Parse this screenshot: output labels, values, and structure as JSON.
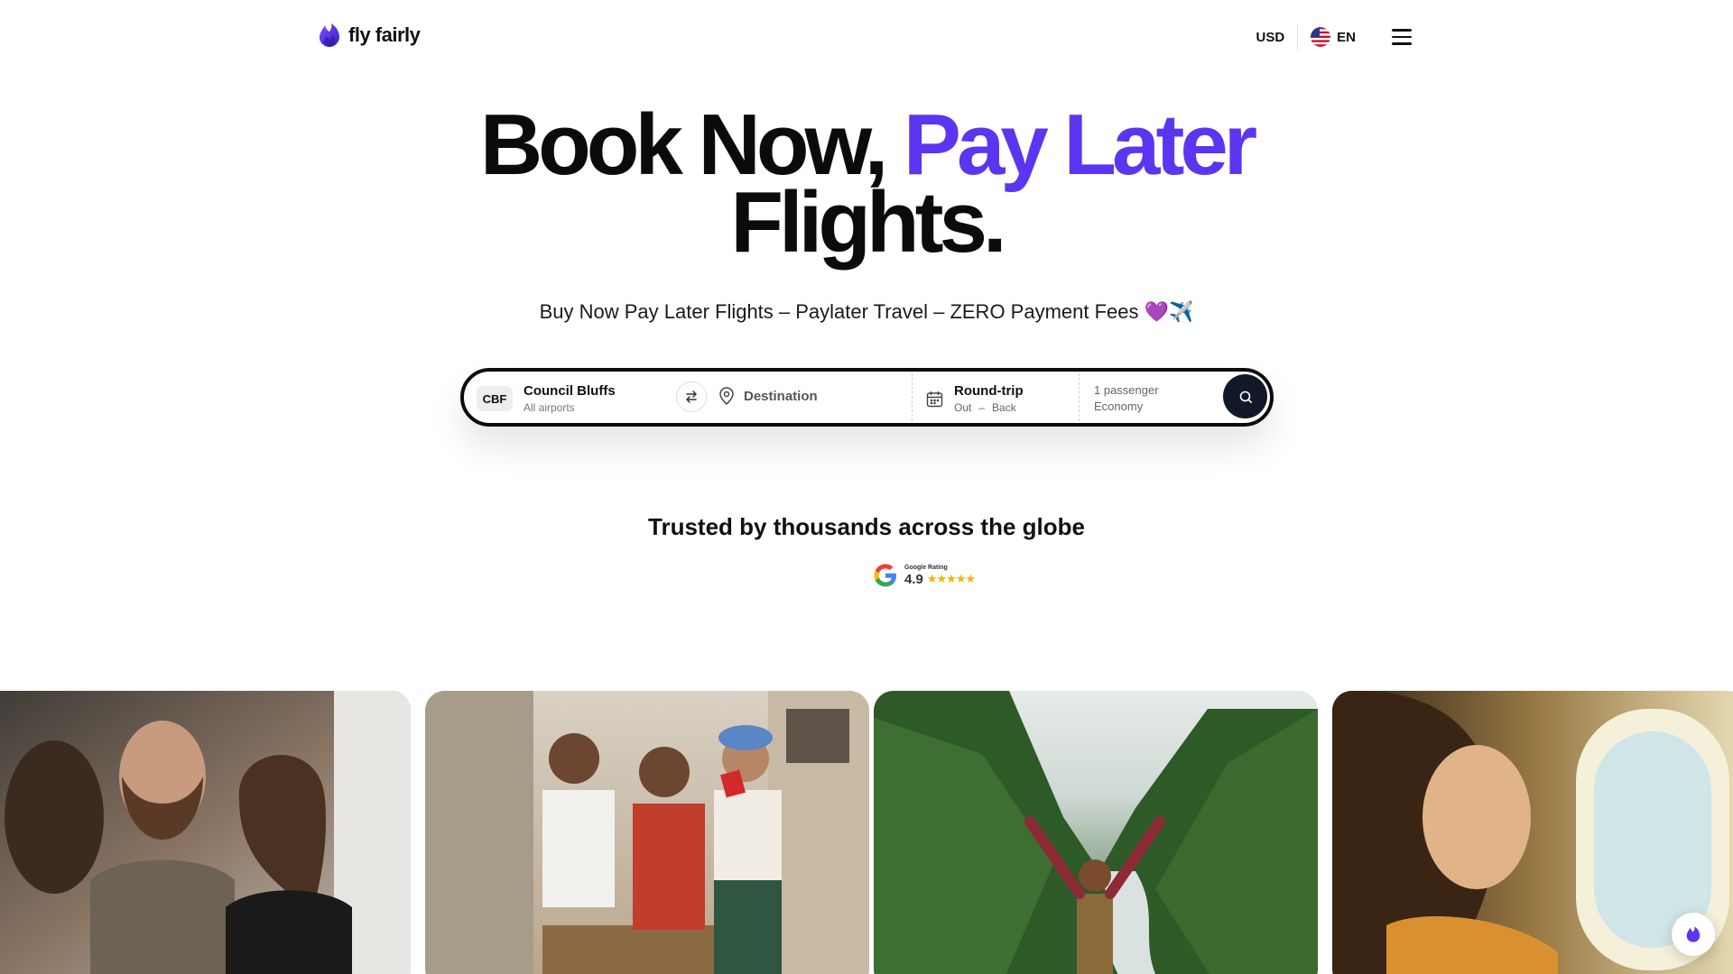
{
  "header": {
    "brand": "fly fairly",
    "currency": "USD",
    "language": "EN",
    "icons": {
      "logo": "flame-logo-icon",
      "flag": "us-flag-icon",
      "menu": "hamburger-menu-icon"
    }
  },
  "hero": {
    "title_part1": "Book Now,",
    "title_accent": "Pay Later",
    "title_part2": "Flights.",
    "subtitle": "Buy Now Pay Later Flights – Paylater Travel – ZERO Payment Fees 💜✈️"
  },
  "search": {
    "origin_code": "CBF",
    "origin_city": "Council Bluffs",
    "origin_sub": "All airports",
    "destination_placeholder": "Destination",
    "trip_type": "Round-trip",
    "date_out": "Out",
    "date_separator": "–",
    "date_back": "Back",
    "passengers": "1 passenger",
    "cabin": "Economy",
    "icons": {
      "swap": "swap-arrows-icon",
      "pin": "location-pin-icon",
      "calendar": "calendar-icon",
      "search": "search-icon"
    }
  },
  "trust": {
    "heading": "Trusted by thousands across the globe",
    "rating_caption": "Google Rating",
    "rating_value": "4.9",
    "stars": "★★★★★",
    "icons": {
      "google": "google-g-icon",
      "star": "star-icon"
    }
  },
  "gallery": [
    {
      "name": "friends-laughing-on-plane-photo"
    },
    {
      "name": "friends-celebrating-street-photo"
    },
    {
      "name": "hiker-valley-photo"
    },
    {
      "name": "woman-window-seat-photo"
    }
  ],
  "colors": {
    "accent": "#5b35f0",
    "dark": "#0b0b0b",
    "star": "#f5b400",
    "search_button": "#111827"
  }
}
